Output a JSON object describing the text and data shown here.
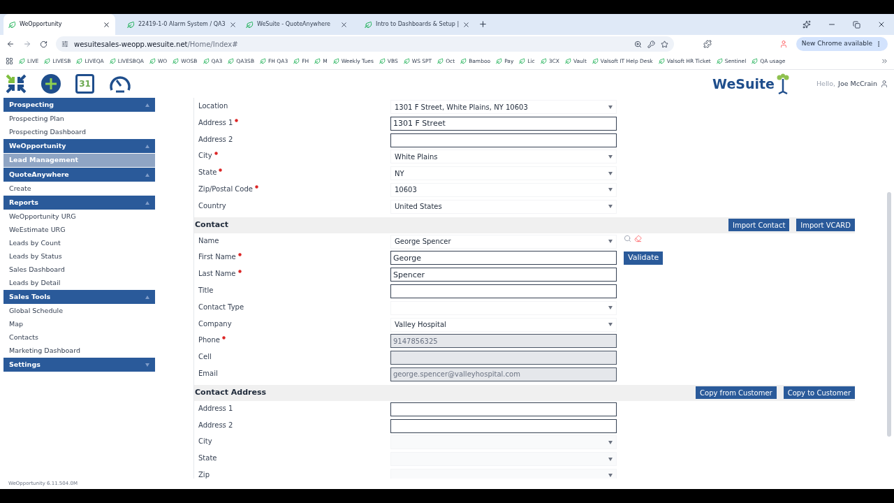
{
  "browser": {
    "tabs": [
      {
        "title": "WeOpportunity",
        "selected": true
      },
      {
        "title": "22419-1-0 Alarm System / QA3",
        "selected": false
      },
      {
        "title": "WeSuite - QuoteAnywhere",
        "selected": false
      },
      {
        "title": "Intro to Dashboards & Setup |",
        "selected": false
      }
    ],
    "url_host": "wesuitesales-weopp.wesuite.net",
    "url_path": "/Home/Index#",
    "update_button": "New Chrome available",
    "bookmarks": [
      "LIVE",
      "LIVESB",
      "LIVEQA",
      "LIVESBQA",
      "WO",
      "WOSB",
      "QA3",
      "QA3SB",
      "FH QA3",
      "FH",
      "M",
      "Weekly Tues",
      "VBS",
      "WS SPT",
      "Oct",
      "Bamboo",
      "Pay",
      "Lic",
      "3CX",
      "Vault",
      "Valsoft IT Help Desk",
      "Valsoft HR Ticket",
      "Sentinel",
      "QA usage"
    ]
  },
  "header": {
    "calendar_day": "31",
    "logo": "WeSuite",
    "greeting": "Hello,",
    "user": "Joe McCrain"
  },
  "sidebar": [
    {
      "title": "Prospecting",
      "expanded": true,
      "items": [
        {
          "label": "Prospecting Plan",
          "selected": false
        },
        {
          "label": "Prospecting Dashboard",
          "selected": false
        }
      ]
    },
    {
      "title": "WeOpportunity",
      "expanded": true,
      "items": [
        {
          "label": "Lead Management",
          "selected": true
        }
      ]
    },
    {
      "title": "QuoteAnywhere",
      "expanded": true,
      "items": [
        {
          "label": "Create",
          "selected": false
        }
      ]
    },
    {
      "title": "Reports",
      "expanded": true,
      "items": [
        {
          "label": "WeOpportunity URG",
          "selected": false
        },
        {
          "label": "WeEstimate URG",
          "selected": false
        },
        {
          "label": "Leads by Count",
          "selected": false
        },
        {
          "label": "Leads by Status",
          "selected": false
        },
        {
          "label": "Sales Dashboard",
          "selected": false
        },
        {
          "label": "Leads by Detail",
          "selected": false
        }
      ]
    },
    {
      "title": "Sales Tools",
      "expanded": true,
      "items": [
        {
          "label": "Global Schedule",
          "selected": false
        },
        {
          "label": "Map",
          "selected": false
        },
        {
          "label": "Contacts",
          "selected": false
        },
        {
          "label": "Marketing Dashboard",
          "selected": false
        }
      ]
    },
    {
      "title": "Settings",
      "expanded": false
    }
  ],
  "form": {
    "sections": [
      {
        "fields": [
          {
            "label": "Location",
            "required": false,
            "kind": "select",
            "value": "1301 F Street, White Plains, NY 10603"
          },
          {
            "label": "Address 1",
            "required": true,
            "kind": "input",
            "value": "1301 F Street"
          },
          {
            "label": "Address 2",
            "required": false,
            "kind": "input"
          },
          {
            "label": "City",
            "required": true,
            "kind": "select",
            "value": "White Plains"
          },
          {
            "label": "State",
            "required": true,
            "kind": "select",
            "value": "NY"
          },
          {
            "label": "Zip/Postal Code",
            "required": true,
            "kind": "select",
            "value": "10603"
          },
          {
            "label": "Country",
            "required": false,
            "kind": "select",
            "value": "United States"
          }
        ]
      },
      {
        "title": "Contact",
        "buttons": [
          "Import Contact",
          "Import VCARD"
        ],
        "fields": [
          {
            "label": "Name",
            "required": false,
            "kind": "select",
            "value": "George Spencer",
            "tools": true
          },
          {
            "label": "First Name",
            "required": true,
            "kind": "input",
            "value": "George",
            "button": "Validate"
          },
          {
            "label": "Last Name",
            "required": true,
            "kind": "input",
            "value": "Spencer"
          },
          {
            "label": "Title",
            "required": false,
            "kind": "input"
          },
          {
            "label": "Contact Type",
            "required": false,
            "kind": "select"
          },
          {
            "label": "Company",
            "required": false,
            "kind": "select",
            "value": "Valley Hospital"
          },
          {
            "label": "Phone",
            "required": true,
            "kind": "disabled",
            "value": "9147856325"
          },
          {
            "label": "Cell",
            "required": false,
            "kind": "disabled"
          },
          {
            "label": "Email",
            "required": false,
            "kind": "disabled",
            "value": "george.spencer@valleyhospital.com"
          }
        ]
      },
      {
        "title": "Contact Address",
        "buttons": [
          "Copy from Customer",
          "Copy to Customer"
        ],
        "fields": [
          {
            "label": "Address 1",
            "required": false,
            "kind": "input"
          },
          {
            "label": "Address 2",
            "required": false,
            "kind": "input"
          },
          {
            "label": "City",
            "required": false,
            "kind": "empty-select"
          },
          {
            "label": "State",
            "required": false,
            "kind": "empty-select"
          },
          {
            "label": "Zip",
            "required": false,
            "kind": "empty-select"
          }
        ]
      }
    ]
  },
  "footer": {
    "version": "WeOpportunity 6.11.504.0M"
  }
}
